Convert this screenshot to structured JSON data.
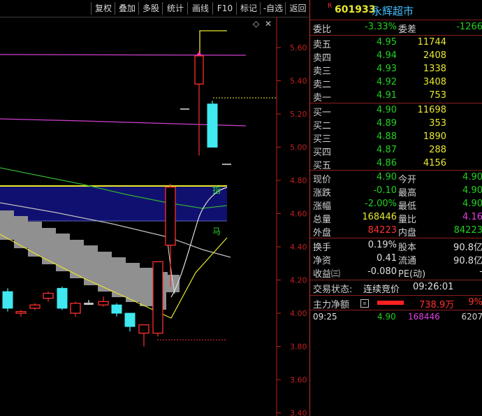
{
  "toolbar": {
    "buttons": [
      "复权",
      "叠加",
      "多股",
      "统计",
      "画线",
      "F10",
      "标记",
      "-自选",
      "返回"
    ]
  },
  "chart": {
    "y_ticks": [
      "5.60",
      "5.40",
      "5.20",
      "5.00",
      "4.80",
      "4.60",
      "4.40",
      "4.20",
      "4.00",
      "3.80",
      "3.60",
      "3.40"
    ],
    "annotations": [
      "指",
      "马"
    ],
    "diamond_icon": "diamond-icon"
  },
  "chart_data": {
    "type": "candlestick",
    "ylim": [
      3.4,
      5.7
    ],
    "candles": [
      {
        "open": 4.03,
        "close": 4.13,
        "high": 4.15,
        "low": 4.01,
        "dir": "down"
      },
      {
        "open": 4.01,
        "close": 4.0,
        "high": 4.02,
        "low": 3.98,
        "dir": "up"
      },
      {
        "open": 4.03,
        "close": 4.05,
        "high": 4.06,
        "low": 4.02,
        "dir": "up"
      },
      {
        "open": 4.09,
        "close": 4.12,
        "high": 4.13,
        "low": 4.07,
        "dir": "up"
      },
      {
        "open": 4.03,
        "close": 4.15,
        "high": 4.16,
        "low": 4.02,
        "dir": "down"
      },
      {
        "open": 4.0,
        "close": 4.06,
        "high": 4.07,
        "low": 3.98,
        "dir": "up"
      },
      {
        "open": 4.06,
        "close": 4.06,
        "high": 4.08,
        "low": 4.05,
        "dir": "doji"
      },
      {
        "open": 4.05,
        "close": 4.07,
        "high": 4.1,
        "low": 4.04,
        "dir": "up"
      },
      {
        "open": 4.05,
        "close": 4.0,
        "high": 4.06,
        "low": 3.98,
        "dir": "down"
      },
      {
        "open": 4.0,
        "close": 3.92,
        "high": 4.0,
        "low": 3.89,
        "dir": "down"
      },
      {
        "open": 3.88,
        "close": 3.93,
        "high": 3.93,
        "low": 3.8,
        "dir": "up"
      },
      {
        "open": 3.88,
        "close": 4.31,
        "high": 4.31,
        "low": 3.86,
        "dir": "up"
      },
      {
        "open": 4.41,
        "close": 4.76,
        "high": 4.78,
        "low": 4.16,
        "dir": "up"
      },
      {
        "open": 5.38,
        "close": 5.55,
        "high": 5.58,
        "low": 4.95,
        "dir": "up"
      },
      {
        "open": 5.0,
        "close": 5.26,
        "high": 5.28,
        "low": 5.0,
        "dir": "down"
      }
    ]
  },
  "quote": {
    "code": "601933",
    "name": "永辉超市",
    "tag": "R",
    "weibi_label": "委比",
    "weibi": "-3.33%",
    "weicha_label": "委差",
    "weicha": "-1266",
    "sell": [
      {
        "label": "卖五",
        "price": "4.95",
        "vol": "11744"
      },
      {
        "label": "卖四",
        "price": "4.94",
        "vol": "2408"
      },
      {
        "label": "卖三",
        "price": "4.93",
        "vol": "1338"
      },
      {
        "label": "卖二",
        "price": "4.92",
        "vol": "3408"
      },
      {
        "label": "卖一",
        "price": "4.91",
        "vol": "753"
      }
    ],
    "buy": [
      {
        "label": "买一",
        "price": "4.90",
        "vol": "11698"
      },
      {
        "label": "买二",
        "price": "4.89",
        "vol": "353"
      },
      {
        "label": "买三",
        "price": "4.88",
        "vol": "1890"
      },
      {
        "label": "买四",
        "price": "4.87",
        "vol": "288"
      },
      {
        "label": "买五",
        "price": "4.86",
        "vol": "4156"
      }
    ],
    "stats": [
      {
        "l1": "现价",
        "v1": "4.90",
        "c1": "green",
        "l2": "今开",
        "v2": "4.90",
        "c2": "green"
      },
      {
        "l1": "涨跌",
        "v1": "-0.10",
        "c1": "green",
        "l2": "最高",
        "v2": "4.90",
        "c2": "green"
      },
      {
        "l1": "涨幅",
        "v1": "-2.00%",
        "c1": "green",
        "l2": "最低",
        "v2": "4.90",
        "c2": "green"
      },
      {
        "l1": "总量",
        "v1": "168446",
        "c1": "yellow",
        "l2": "量比",
        "v2": "4.16",
        "c2": "magenta"
      },
      {
        "l1": "外盘",
        "v1": "84223",
        "c1": "red",
        "l2": "内盘",
        "v2": "84223",
        "c2": "green"
      }
    ],
    "stats2": [
      {
        "l1": "换手",
        "v1": "0.19%",
        "l2": "股本",
        "v2": "90.8亿"
      },
      {
        "l1": "净资",
        "v1": "0.41",
        "l2": "流通",
        "v2": "90.8亿"
      },
      {
        "l1": "收益㈢",
        "v1": "-0.080",
        "l2": "PE(动)",
        "v2": "-"
      }
    ],
    "trade_status_label": "交易状态:",
    "trade_status": "连续竞价",
    "trade_time": "09:26:01",
    "main_flow_label": "主力净额",
    "main_flow_value": "738.9万",
    "main_flow_pct": "9%",
    "tick": {
      "time": "09:25",
      "price": "4.90",
      "vol": "168446",
      "extra": "6207"
    }
  },
  "colors": {
    "up": "#ff3030",
    "down": "#40e8f0",
    "bg": "#000000",
    "band": "#101070",
    "cloud": "#909090"
  }
}
